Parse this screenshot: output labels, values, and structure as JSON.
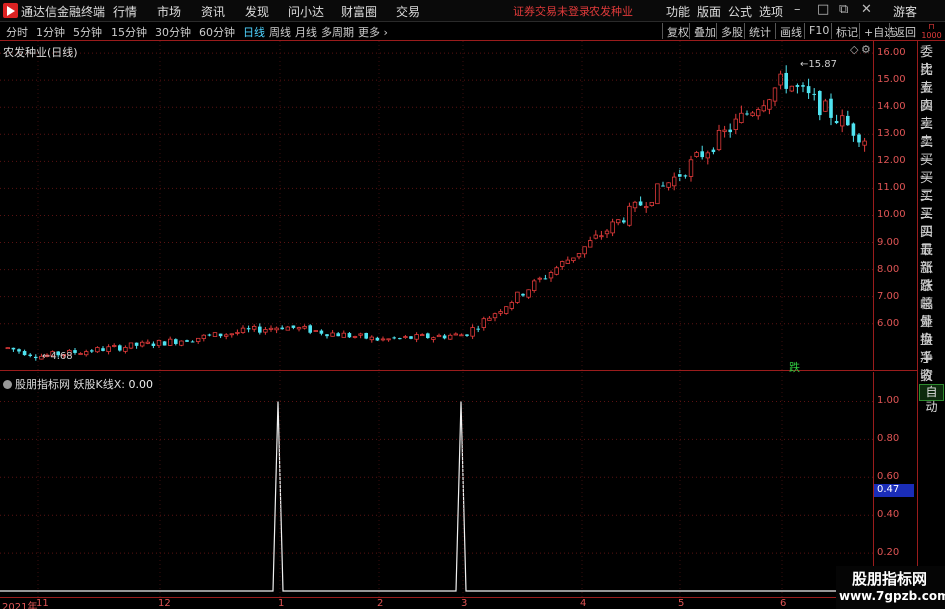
{
  "menubar": {
    "app_title": "通达信金融终端",
    "items": [
      "行情",
      "市场",
      "资讯",
      "发现",
      "问小达",
      "财富圈",
      "交易"
    ],
    "notice": "证券交易未登录",
    "stock_name": "农发种业",
    "right_items": [
      "功能",
      "版面",
      "公式",
      "选项"
    ],
    "guest": "游客"
  },
  "periodbar": {
    "periods": [
      "分时",
      "1分钟",
      "5分钟",
      "15分钟",
      "30分钟",
      "60分钟",
      "日线",
      "周线",
      "月线",
      "多周期",
      "更多"
    ],
    "active": "日线",
    "tools": [
      "复权",
      "叠加",
      "多股",
      "统计",
      "画线",
      "F10",
      "标记",
      "+自选",
      "返回"
    ]
  },
  "main_chart": {
    "label": "农发种业(日线)",
    "high_label": "15.87",
    "low_label": "4.68",
    "signal_tag": "跌",
    "y_ticks": [
      "16.00",
      "15.00",
      "14.00",
      "13.00",
      "12.00",
      "11.00",
      "10.00",
      "9.00",
      "8.00",
      "7.00",
      "6.00"
    ]
  },
  "sub_chart": {
    "source": "股朋指标网",
    "indicator": "妖股K线X:",
    "value": "0.00",
    "y_ticks": [
      "1.00",
      "0.80",
      "0.60",
      "0.40",
      "0.20"
    ],
    "current": "0.47"
  },
  "time_axis": [
    "2021年",
    "11",
    "12",
    "1",
    "2",
    "3",
    "4",
    "5",
    "6"
  ],
  "right_panel": [
    "委比",
    "卖五",
    "卖四",
    "卖三",
    "卖二",
    "卖一",
    "买一",
    "买二",
    "买三",
    "买四",
    "买五",
    "最新",
    "涨跌",
    "涨幅",
    "总量",
    "外盘",
    "换手",
    "净资",
    "收益"
  ],
  "right_panel_auto": "自动",
  "corner_text": "1000",
  "watermark": {
    "name": "股朋指标网",
    "url": "www.7gpzb.com"
  },
  "colors": {
    "up": "#e03a3a",
    "down": "#4fe3f0",
    "grid": "#9a1c1c",
    "active": "#4fd3ff"
  },
  "chart_data": [
    {
      "type": "candlestick",
      "title": "农发种业(日线)",
      "ylim": [
        4.4,
        16.3
      ],
      "x_labels": [
        "2021年",
        "11",
        "12",
        "1",
        "2",
        "3",
        "4",
        "5",
        "6"
      ],
      "anchors": [
        {
          "x": "2021年",
          "close": 5.1
        },
        {
          "x": "11",
          "close": 4.8
        },
        {
          "x": "12",
          "close": 5.3
        },
        {
          "x": "1",
          "close": 5.9
        },
        {
          "x": "2",
          "close": 5.4
        },
        {
          "x": "3",
          "close": 5.6
        },
        {
          "x": "4",
          "close": 8.8
        },
        {
          "x": "5",
          "close": 11.6
        },
        {
          "x": "6",
          "close": 15.0
        },
        {
          "x": "end",
          "close": 12.6
        }
      ],
      "high": 15.87,
      "low": 4.68
    },
    {
      "type": "line",
      "title": "妖股K线X",
      "ylim": [
        0,
        1.05
      ],
      "spikes": [
        {
          "x": "1",
          "value": 1.0
        },
        {
          "x": "3",
          "value": 1.0
        }
      ],
      "baseline": 0.0
    }
  ]
}
